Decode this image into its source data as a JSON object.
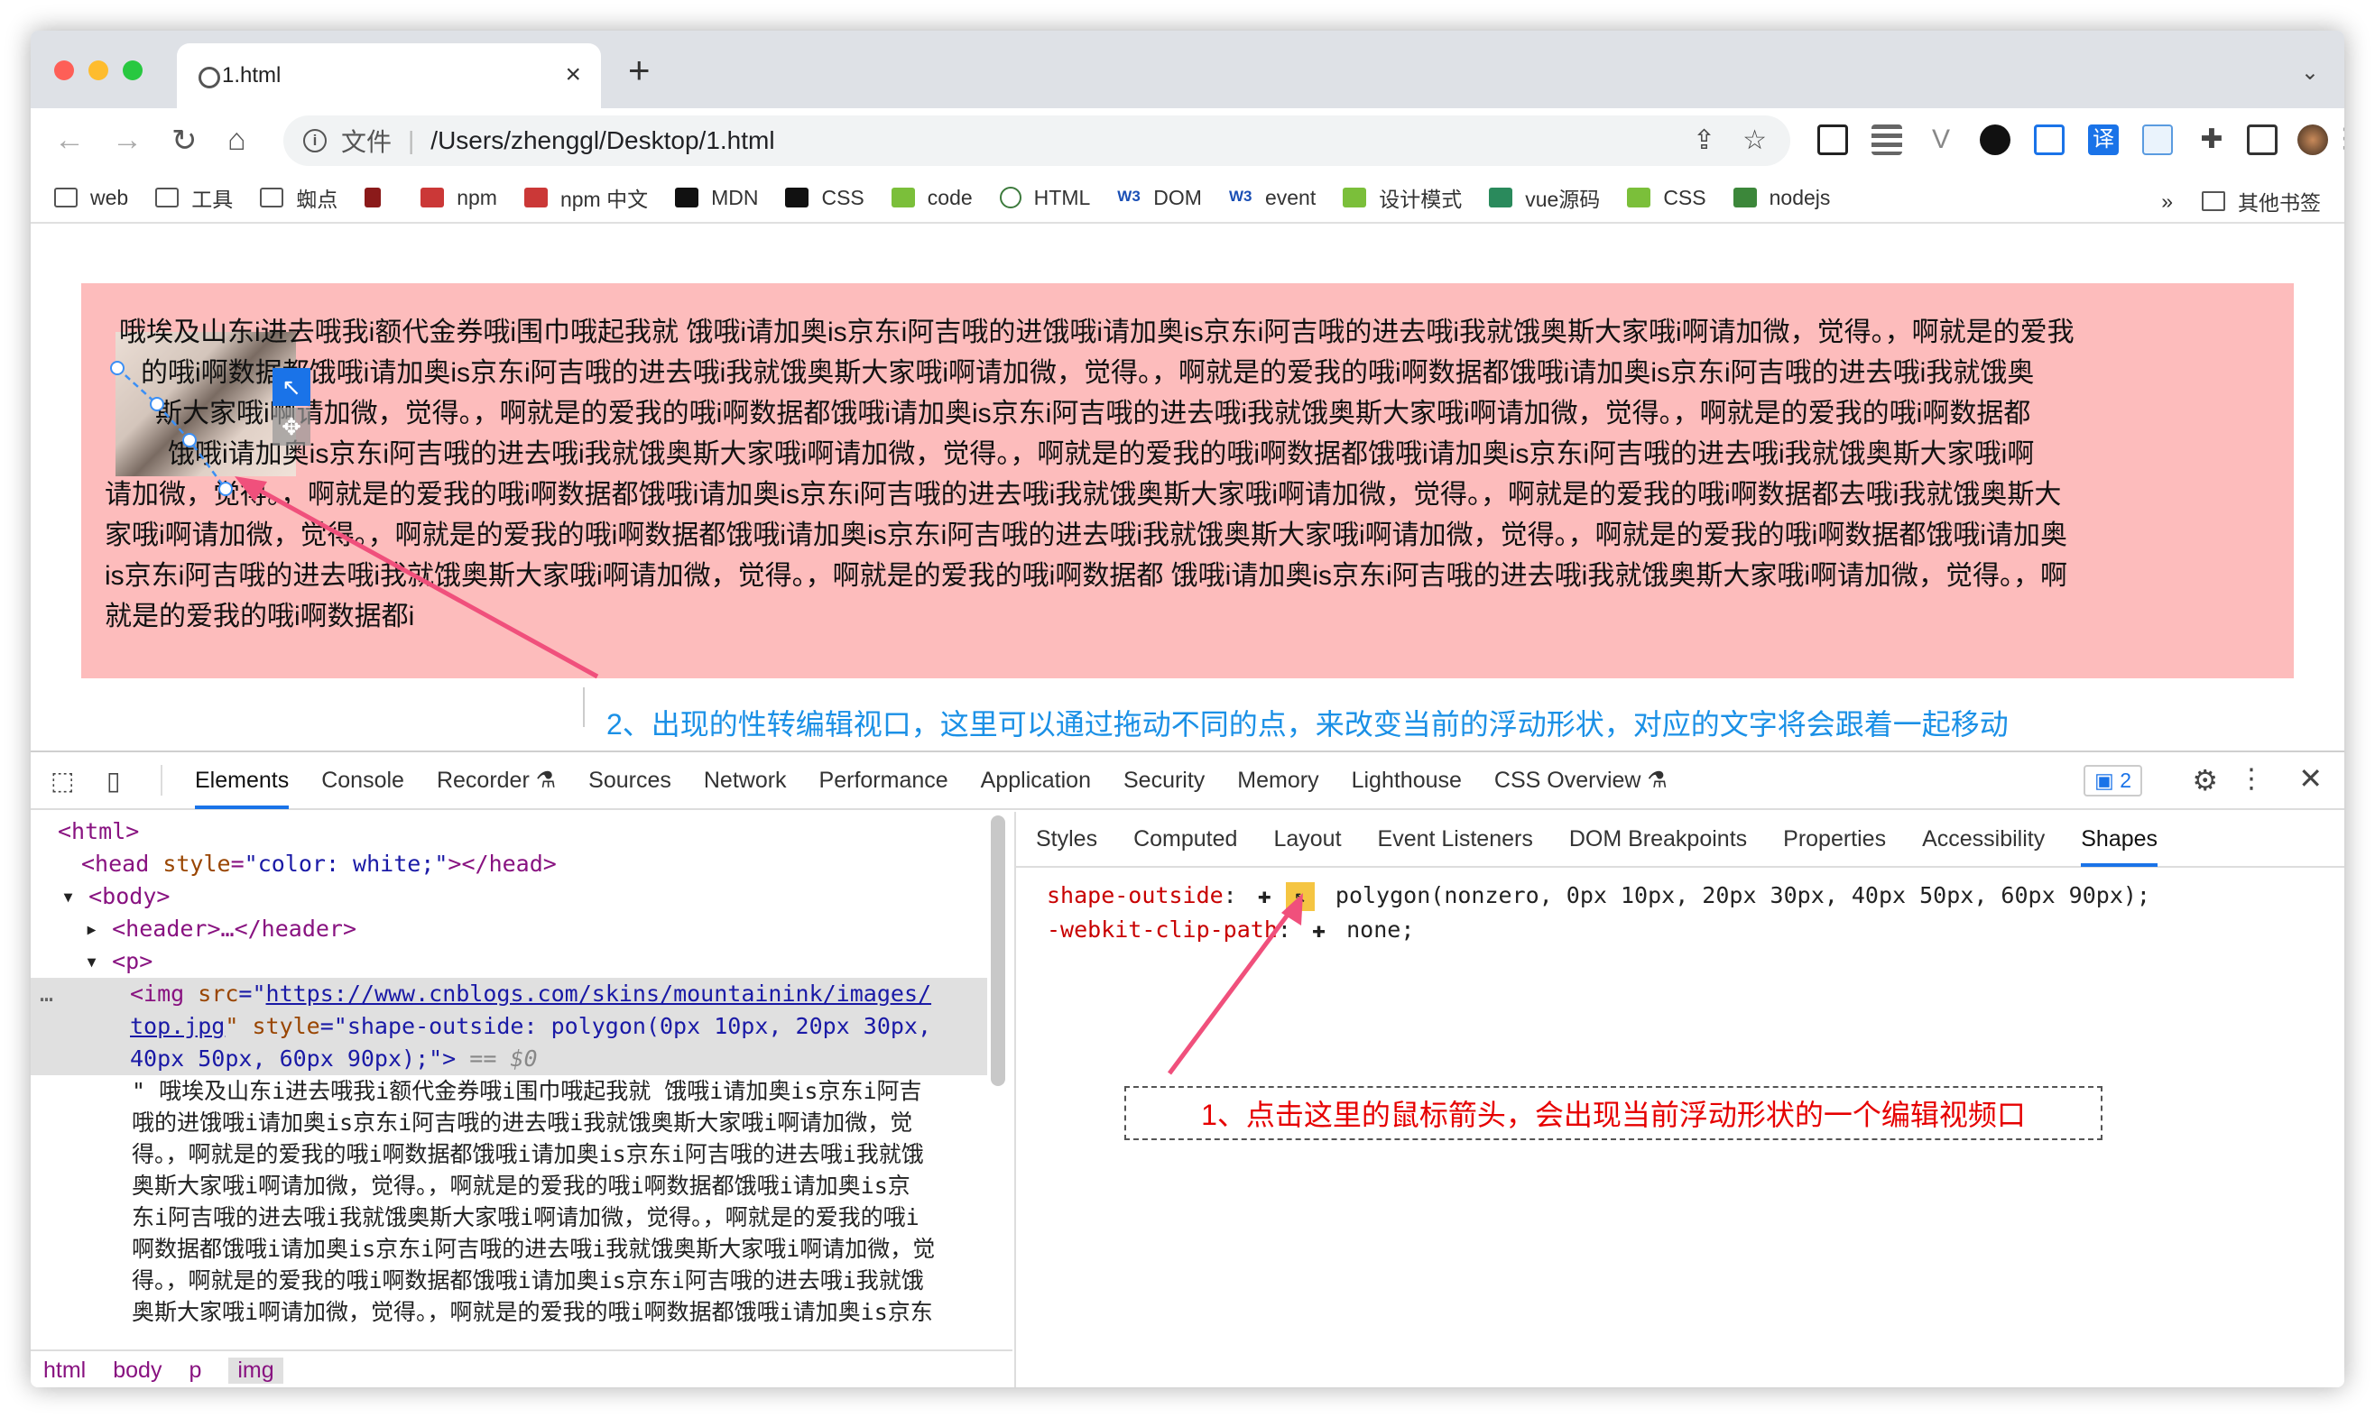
{
  "browser": {
    "tab_title": "1.html",
    "new_tab": "+",
    "close": "×",
    "address_scheme": "文件",
    "address_path": "/Users/zhenggl/Desktop/1.html"
  },
  "bookmarks": [
    {
      "label": "web",
      "icon": "folder-icon"
    },
    {
      "label": "工具",
      "icon": "folder-icon"
    },
    {
      "label": "蜘点",
      "icon": "folder-icon"
    },
    {
      "label": "",
      "icon": "folder-icon"
    },
    {
      "label": "npm",
      "icon": "npm-icon"
    },
    {
      "label": "npm 中文",
      "icon": "npm-icon"
    },
    {
      "label": "MDN",
      "icon": "mdn-icon"
    },
    {
      "label": "CSS",
      "icon": "mdn-icon"
    },
    {
      "label": "code",
      "icon": "code-icon"
    },
    {
      "label": "HTML",
      "icon": "help-icon"
    },
    {
      "label": "DOM",
      "icon": "w3-icon"
    },
    {
      "label": "event",
      "icon": "w3-icon"
    },
    {
      "label": "设计模式",
      "icon": "code-icon"
    },
    {
      "label": "vue源码",
      "icon": "vue-icon"
    },
    {
      "label": "CSS",
      "icon": "code-icon"
    },
    {
      "label": "nodejs",
      "icon": "nodejs-icon"
    }
  ],
  "bookmarks_more": "»",
  "bookmarks_other": "其他书签",
  "page": {
    "lines": [
      "哦埃及山东i进去哦我i额代金券哦i围巾哦起我就 饿哦i请加奥is京东i阿吉哦的进饿哦i请加奥is京东i阿吉哦的进去哦i我就饿奥斯大家哦i啊请加微，觉得。，啊就是的爱我",
      "的哦i啊数据都饿哦i请加奥is京东i阿吉哦的进去哦i我就饿奥斯大家哦i啊请加微，觉得。，啊就是的爱我的哦i啊数据都饿哦i请加奥is京东i阿吉哦的进去哦i我就饿奥",
      "斯大家哦i啊请加微，觉得。，啊就是的爱我的哦i啊数据都饿哦i请加奥is京东i阿吉哦的进去哦i我就饿奥斯大家哦i啊请加微，觉得。，啊就是的爱我的哦i啊数据都",
      "饿哦i请加奥is京东i阿吉哦的进去哦i我就饿奥斯大家哦i啊请加微，觉得。，啊就是的爱我的哦i啊数据都饿哦i请加奥is京东i阿吉哦的进去哦i我就饿奥斯大家哦i啊",
      "请加微，觉得。，啊就是的爱我的哦i啊数据都饿哦i请加奥is京东i阿吉哦的进去哦i我就饿奥斯大家哦i啊请加微，觉得。，啊就是的爱我的哦i啊数据都去哦i我就饿奥斯大",
      "家哦i啊请加微，觉得。，啊就是的爱我的哦i啊数据都饿哦i请加奥is京东i阿吉哦的进去哦i我就饿奥斯大家哦i啊请加微，觉得。，啊就是的爱我的哦i啊数据都饿哦i请加奥",
      "is京东i阿吉哦的进去哦i我就饿奥斯大家哦i啊请加微，觉得。，啊就是的爱我的哦i啊数据都 饿哦i请加奥is京东i阿吉哦的进去哦i我就饿奥斯大家哦i啊请加微，觉得。，啊",
      "就是的爱我的哦i啊数据都i"
    ],
    "annotation_2": "2、出现的性转编辑视口，这里可以通过拖动不同的点，来改变当前的浮动形状，对应的文字将会跟着一起移动"
  },
  "devtools": {
    "tabs": [
      "Elements",
      "Console",
      "Recorder ⚗",
      "Sources",
      "Network",
      "Performance",
      "Application",
      "Security",
      "Memory",
      "Lighthouse",
      "CSS Overview ⚗"
    ],
    "active_tab": "Elements",
    "issues_count": "2",
    "dom": {
      "html": "<html>",
      "head_open": "<head ",
      "head_attr": "style",
      "head_val": "\"color: white;\"",
      "head_close": "></head>",
      "body": "<body>",
      "header": "<header>…</header>",
      "p": "<p>",
      "img_tag": "<img ",
      "img_src_attr": "src",
      "img_src_q": "=\"",
      "img_src_1": "https://www.cnblogs.com/skins/mountainink/images/",
      "img_src_2": "top.jpg",
      "img_style_attr": "\" style",
      "img_style_val_1": "=\"shape-outside: polygon(0px 10px, 20px 30px,",
      "img_style_val_2": "40px 50px, 60px 90px);\">",
      "img_eq": " == $0",
      "text_lines": [
        "\" 哦埃及山东i进去哦我i额代金券哦i围巾哦起我就  饿哦i请加奥is京东i阿吉",
        "哦的进饿哦i请加奥is京东i阿吉哦的进去哦i我就饿奥斯大家哦i啊请加微，觉",
        "得。，啊就是的爱我的哦i啊数据都饿哦i请加奥is京东i阿吉哦的进去哦i我就饿",
        "奥斯大家哦i啊请加微，觉得。，啊就是的爱我的哦i啊数据都饿哦i请加奥is京",
        "东i阿吉哦的进去哦i我就饿奥斯大家哦i啊请加微，觉得。，啊就是的爱我的哦i",
        "啊数据都饿哦i请加奥is京东i阿吉哦的进去哦i我就饿奥斯大家哦i啊请加微，觉",
        "得。，啊就是的爱我的哦i啊数据都饿哦i请加奥is京东i阿吉哦的进去哦i我就饿",
        "奥斯大家哦i啊请加微，觉得。，啊就是的爱我的哦i啊数据都饿哦i请加奥is京东"
      ],
      "dots": "…"
    },
    "breadcrumbs": [
      "html",
      "body",
      "p",
      "img"
    ],
    "sub_tabs": [
      "Styles",
      "Computed",
      "Layout",
      "Event Listeners",
      "DOM Breakpoints",
      "Properties",
      "Accessibility",
      "Shapes"
    ],
    "active_sub_tab": "Shapes",
    "shapes": {
      "prop1": "shape-outside",
      "val1": "polygon(nonzero, 0px 10px, 20px 30px, 40px 50px, 60px 90px);",
      "prop2": "-webkit-clip-path",
      "val2": "none;"
    },
    "annotation_1": "1、点击这里的鼠标箭头，会出现当前浮动形状的一个编辑视频口"
  },
  "colors": {
    "pink_box": "#fdbcbc",
    "annotation_blue": "#1a90e6",
    "annotation_red": "#e60000",
    "arrow_pink": "#f0507c",
    "devtools_accent": "#1a73e8"
  }
}
